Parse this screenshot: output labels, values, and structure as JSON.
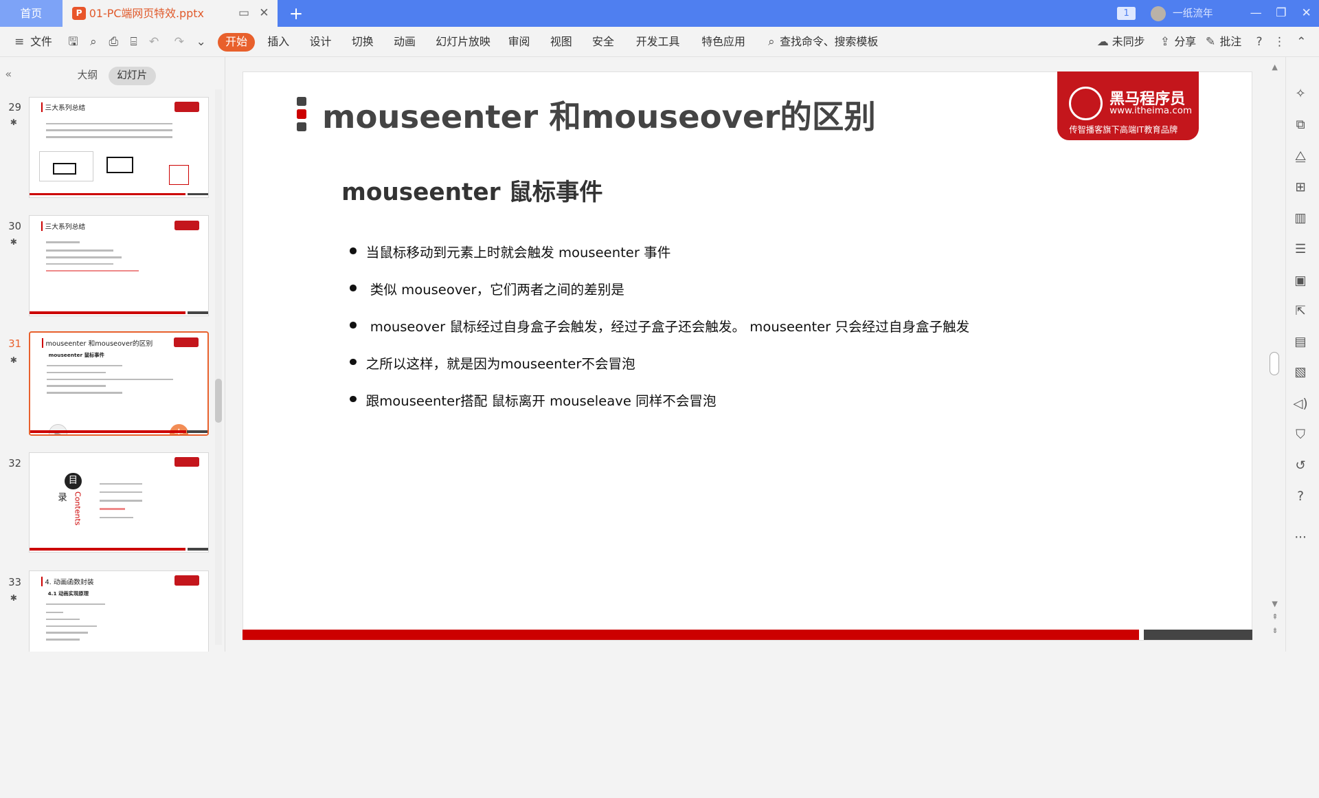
{
  "tabs": {
    "home": "首页",
    "doc": "01-PC端网页特效.pptx",
    "ppt_letter": "P",
    "page_badge": "1",
    "user": "一纸流年"
  },
  "toolbar": {
    "file": "文件",
    "menus": [
      "开始",
      "插入",
      "设计",
      "切换",
      "动画",
      "幻灯片放映",
      "审阅",
      "视图",
      "安全",
      "开发工具",
      "特色应用"
    ],
    "search": "查找命令、搜索模板",
    "sync": "未同步",
    "share": "分享",
    "comment": "批注"
  },
  "left_panel": {
    "outline_tab": "大纲",
    "slides_tab": "幻灯片",
    "slides": [
      {
        "num": "29",
        "title": "三大系列总结"
      },
      {
        "num": "30",
        "title": "三大系列总结"
      },
      {
        "num": "31",
        "title": "mouseenter 和mouseover的区别",
        "subtitle": "mouseenter 鼠标事件"
      },
      {
        "num": "32",
        "title": "目",
        "title2": "录",
        "contents": "Contents"
      },
      {
        "num": "33",
        "title": "4. 动画函数封装",
        "subtitle": "4.1 动画实现原理"
      }
    ]
  },
  "slide": {
    "title": "mouseenter 和mouseover的区别",
    "logo_name": "黑马程序员",
    "logo_url": "www.itheima.com",
    "logo_tag": "传智播客旗下高端IT教育品牌",
    "subtitle": "mouseenter 鼠标事件",
    "bullets": [
      "当鼠标移动到元素上时就会触发 mouseenter 事件",
      "类似 mouseover，它们两者之间的差别是",
      "mouseover 鼠标经过自身盒子会触发，经过子盒子还会触发。 mouseenter  只会经过自身盒子触发",
      "之所以这样，就是因为mouseenter不会冒泡",
      "跟mouseenter搭配 鼠标离开 mouseleave  同样不会冒泡"
    ]
  },
  "colors": {
    "accent": "#e8602c",
    "tabbar": "#4f7ff0",
    "brand_red": "#c4161c"
  }
}
